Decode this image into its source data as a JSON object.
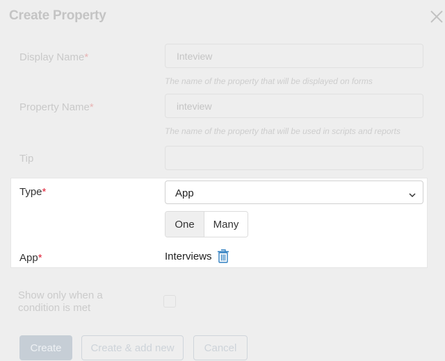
{
  "dialog": {
    "title": "Create Property"
  },
  "fields": {
    "display_name": {
      "label": "Display Name",
      "required_mark": "*",
      "value": "Inteview",
      "hint": "The name of the property that will be displayed on forms"
    },
    "property_name": {
      "label": "Property Name",
      "required_mark": "*",
      "value": "inteview",
      "hint": "The name of the property that will be used in scripts and reports"
    },
    "tip": {
      "label": "Tip",
      "value": ""
    },
    "type": {
      "label": "Type",
      "required_mark": "*",
      "selected": "App",
      "cardinality_options": [
        "One",
        "Many"
      ],
      "cardinality_selected": "One"
    },
    "app": {
      "label": "App",
      "required_mark": "*",
      "value": "Interviews"
    },
    "condition": {
      "label": "Show only when a condition is met",
      "checked": false
    }
  },
  "actions": {
    "create": "Create",
    "create_add_new": "Create & add new",
    "cancel": "Cancel"
  },
  "icons": {
    "close": "close-icon",
    "chevron": "chevron-down-icon",
    "trash": "trash-icon"
  },
  "colors": {
    "required": "#e0243a",
    "trash": "#2f7fc1"
  }
}
